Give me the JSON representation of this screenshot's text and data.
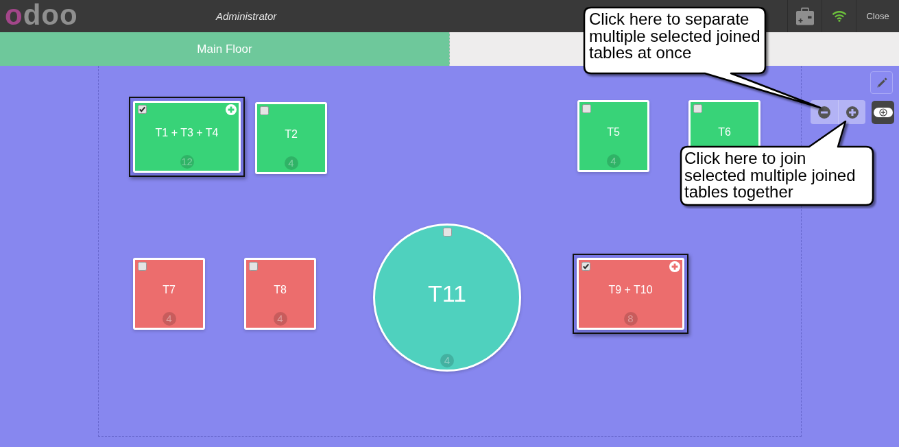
{
  "header": {
    "logo": "odoo",
    "user": "Administrator",
    "close": "Close"
  },
  "floors": [
    {
      "label": "Main Floor",
      "selected": true
    }
  ],
  "tables": [
    {
      "kind": "square",
      "label": "T1 + T3 + T4",
      "seats": "12",
      "color": "#38d378",
      "checked": true,
      "joined": true
    },
    {
      "kind": "square",
      "label": "T2",
      "seats": "4",
      "color": "#38d378",
      "checked": false,
      "joined": false
    },
    {
      "kind": "square",
      "label": "T5",
      "seats": "4",
      "color": "#38d378",
      "checked": false,
      "joined": false
    },
    {
      "kind": "square",
      "label": "T6",
      "color": "#38d378",
      "checked": false,
      "joined": false
    },
    {
      "kind": "square",
      "label": "T7",
      "seats": "4",
      "color": "#ec6d6d",
      "checked": false,
      "joined": false
    },
    {
      "kind": "square",
      "label": "T8",
      "seats": "4",
      "color": "#ec6d6d",
      "checked": false,
      "joined": false
    },
    {
      "kind": "round",
      "label": "T11",
      "seats": "4",
      "color": "#4fd1be",
      "checked": false,
      "joined": false
    },
    {
      "kind": "square",
      "label": "T9 + T10",
      "seats": "8",
      "color": "#ec6d6d",
      "checked": true,
      "joined": true
    }
  ],
  "callouts": [
    {
      "text": "Click here to separate multiple selected joined tables at once"
    },
    {
      "text": "Click here to join selected multiple joined tables together"
    }
  ]
}
